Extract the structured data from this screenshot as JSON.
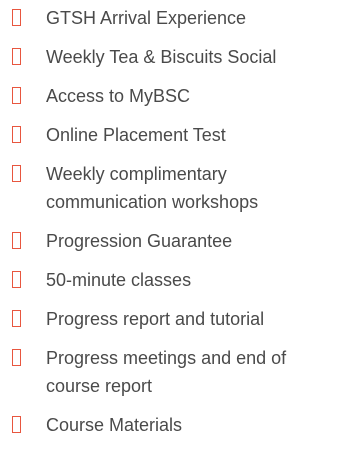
{
  "features": {
    "items": [
      {
        "label": "GTSH Arrival Experience",
        "icon": "missing-glyph-icon"
      },
      {
        "label": "Weekly Tea & Biscuits Social",
        "icon": "missing-glyph-icon"
      },
      {
        "label": "Access to MyBSC",
        "icon": "missing-glyph-icon"
      },
      {
        "label": "Online Placement Test",
        "icon": "missing-glyph-icon"
      },
      {
        "label": "Weekly complimentary communication workshops",
        "icon": "missing-glyph-icon"
      },
      {
        "label": "Progression Guarantee",
        "icon": "missing-glyph-icon"
      },
      {
        "label": "50-minute classes",
        "icon": "missing-glyph-icon"
      },
      {
        "label": "Progress report and tutorial",
        "icon": "missing-glyph-icon"
      },
      {
        "label": "Progress meetings and end of course report",
        "icon": "missing-glyph-icon"
      },
      {
        "label": "Course Materials",
        "icon": "missing-glyph-icon"
      }
    ],
    "icon_color": "#e8563f",
    "text_color": "#4a4a4a"
  }
}
